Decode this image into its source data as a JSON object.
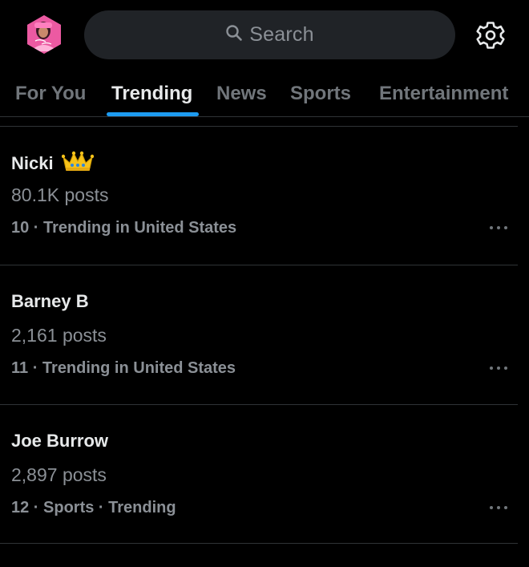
{
  "header": {
    "avatar_icon": "profile-avatar",
    "search": {
      "placeholder": "Search",
      "icon": "search-icon"
    },
    "settings_icon": "gear-icon"
  },
  "tabs": [
    {
      "label": "For You",
      "active": false
    },
    {
      "label": "Trending",
      "active": true
    },
    {
      "label": "News",
      "active": false
    },
    {
      "label": "Sports",
      "active": false
    },
    {
      "label": "Entertainment",
      "active": false
    }
  ],
  "trends": [
    {
      "name": "Nicki",
      "emoji": "crown-emoji",
      "posts": "80.1K posts",
      "context": "10 · Trending in United States"
    },
    {
      "name": "Barney B",
      "posts": "2,161 posts",
      "context": "11 · Trending in United States"
    },
    {
      "name": "Joe Burrow",
      "posts": "2,897 posts",
      "context": "12 · Sports · Trending"
    }
  ],
  "colors": {
    "background": "#000000",
    "accent": "#1d9bf0",
    "text_primary": "#e7e9ea",
    "text_secondary": "#8b9096",
    "search_bg": "#202327",
    "divider": "#2f3336"
  }
}
